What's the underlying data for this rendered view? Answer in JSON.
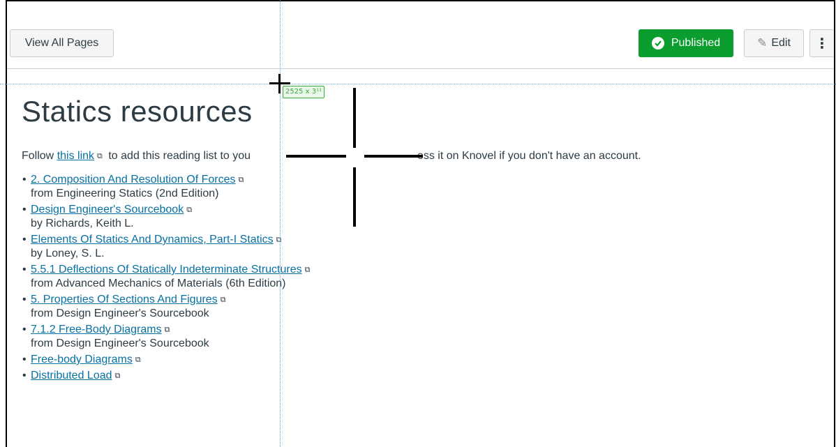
{
  "header": {
    "view_all_label": "View All Pages",
    "published_label": "Published",
    "edit_label": "Edit",
    "more_label": "⋮"
  },
  "page": {
    "title": "Statics resources",
    "intro_before": "Follow ",
    "intro_link": "this link",
    "intro_middle": " to add this reading list to you",
    "intro_after": "access it on Knovel if you don't have an account."
  },
  "resources": [
    {
      "title": "2. Composition And Resolution Of Forces",
      "detail": "from Engineering Statics (2nd Edition)"
    },
    {
      "title": "Design Engineer's Sourcebook",
      "detail": "by Richards, Keith L."
    },
    {
      "title": "Elements Of Statics And Dynamics, Part-I Statics",
      "detail": "by Loney, S. L."
    },
    {
      "title": "5.5.1 Deflections Of Statically Indeterminate Structures",
      "detail": "from Advanced Mechanics of Materials (6th Edition)"
    },
    {
      "title": "5. Properties Of Sections And Figures",
      "detail": "from Design Engineer's Sourcebook"
    },
    {
      "title": "7.1.2 Free-Body Diagrams",
      "detail": "from Design Engineer's Sourcebook"
    },
    {
      "title": "Free-body Diagrams",
      "detail": ""
    },
    {
      "title": "Distributed Load",
      "detail": ""
    }
  ],
  "overlay": {
    "size_readout": "2525 x 3¹¹"
  },
  "colors": {
    "published_green": "#0b9e2f",
    "link_blue": "#0770a3",
    "guide_blue": "#6aa9d6"
  },
  "icons": {
    "published": "check-circle-icon",
    "edit": "pencil-icon",
    "external": "external-link-icon"
  }
}
